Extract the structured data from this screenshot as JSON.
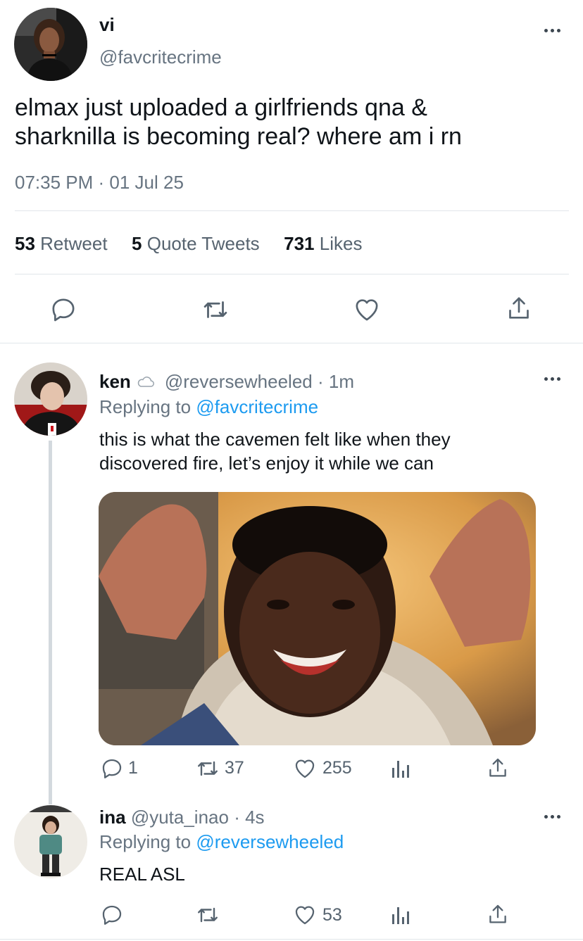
{
  "main_tweet": {
    "name": "vi",
    "handle": "@favcritecrime",
    "text_line1": "elmax just uploaded a girlfriends qna &",
    "text_line2": "sharknilla is becoming real? where am i rn",
    "timestamp": "07:35 PM · 01 Jul 25",
    "stats": {
      "retweets": "53",
      "retweets_label": "Retweet",
      "quotes": "5",
      "quotes_label": "Quote Tweets",
      "likes": "731",
      "likes_label": "Likes"
    },
    "actions": [
      "reply-icon",
      "retweet-icon",
      "like-icon",
      "share-icon"
    ]
  },
  "reply1": {
    "name": "ken",
    "badge_icon": "cloud-icon",
    "handle_time": "@reversewheeled · 1m",
    "replying_prefix": "Replying to",
    "replying_handle": "@favcritecrime",
    "text_line1": "this is what the cavemen felt like when they",
    "text_line2": "discovered fire, let’s enjoy it while we can",
    "counts": {
      "replies": "1",
      "retweets": "37",
      "likes": "255"
    }
  },
  "reply2": {
    "name": "ina",
    "handle_time": "@yuta_inao · 4s",
    "replying_prefix": "Replying to",
    "replying_handle": "@reversewheeled",
    "text": "REAL ASL",
    "counts": {
      "likes": "53"
    }
  },
  "colors": {
    "link": "#1d9bf0",
    "secondary_text": "#677481",
    "divider": "#e1e6ea"
  }
}
